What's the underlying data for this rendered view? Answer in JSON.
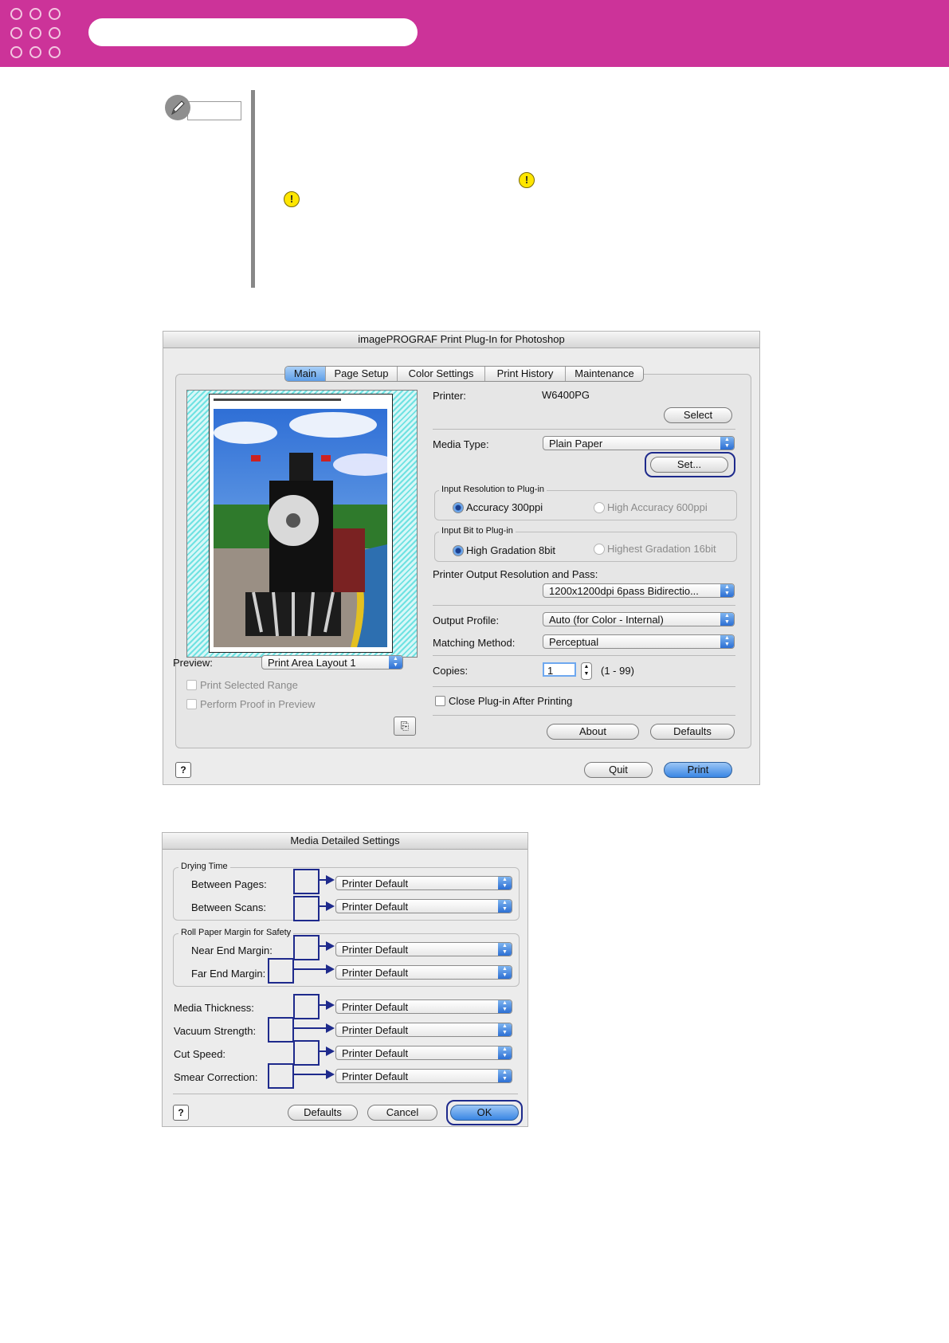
{
  "plugin_dialog": {
    "title": "imagePROGRAF Print Plug-In for Photoshop",
    "tabs": [
      "Main",
      "Page Setup",
      "Color Settings",
      "Print History",
      "Maintenance"
    ],
    "printer_label": "Printer:",
    "printer_value": "W6400PG",
    "select_button": "Select",
    "media_type_label": "Media Type:",
    "media_type_value": "Plain Paper",
    "set_button": "Set...",
    "input_resolution_group": "Input Resolution to Plug-in",
    "accuracy_300": "Accuracy 300ppi",
    "high_accuracy_600": "High Accuracy 600ppi",
    "input_bit_group": "Input Bit to Plug-in",
    "high_gradation_8bit": "High Gradation 8bit",
    "highest_gradation_16bit": "Highest Gradation 16bit",
    "output_resolution_label": "Printer Output Resolution and Pass:",
    "output_resolution_value": "1200x1200dpi 6pass Bidirectio...",
    "output_profile_label": "Output Profile:",
    "output_profile_value": "Auto (for Color - Internal)",
    "matching_method_label": "Matching Method:",
    "matching_method_value": "Perceptual",
    "copies_label": "Copies:",
    "copies_value": "1",
    "copies_range": "(1 - 99)",
    "close_after_print": "Close Plug-in After Printing",
    "about_button": "About",
    "defaults_button": "Defaults",
    "preview_label": "Preview:",
    "preview_value": "Print Area Layout 1",
    "print_selected_range": "Print Selected Range",
    "perform_proof": "Perform Proof in Preview",
    "quit_button": "Quit",
    "print_button": "Print",
    "help_glyph": "?"
  },
  "media_dialog": {
    "title": "Media Detailed Settings",
    "drying_time_group": "Drying Time",
    "between_pages_label": "Between Pages:",
    "between_scans_label": "Between Scans:",
    "roll_margin_group": "Roll Paper Margin for Safety",
    "near_end_label": "Near End Margin:",
    "far_end_label": "Far End Margin:",
    "media_thickness_label": "Media Thickness:",
    "vacuum_strength_label": "Vacuum Strength:",
    "cut_speed_label": "Cut Speed:",
    "smear_correction_label": "Smear Correction:",
    "setting_value": "Printer Default",
    "defaults_button": "Defaults",
    "cancel_button": "Cancel",
    "ok_button": "OK",
    "help_glyph": "?"
  },
  "colors": {
    "banner": "#cc3399",
    "callout": "#1e2a8c",
    "accent_blue": "#3a86e4"
  },
  "icons": [
    "pencil-note-icon",
    "warning-icon",
    "help-icon",
    "popup-arrows-icon",
    "proof-icon"
  ]
}
